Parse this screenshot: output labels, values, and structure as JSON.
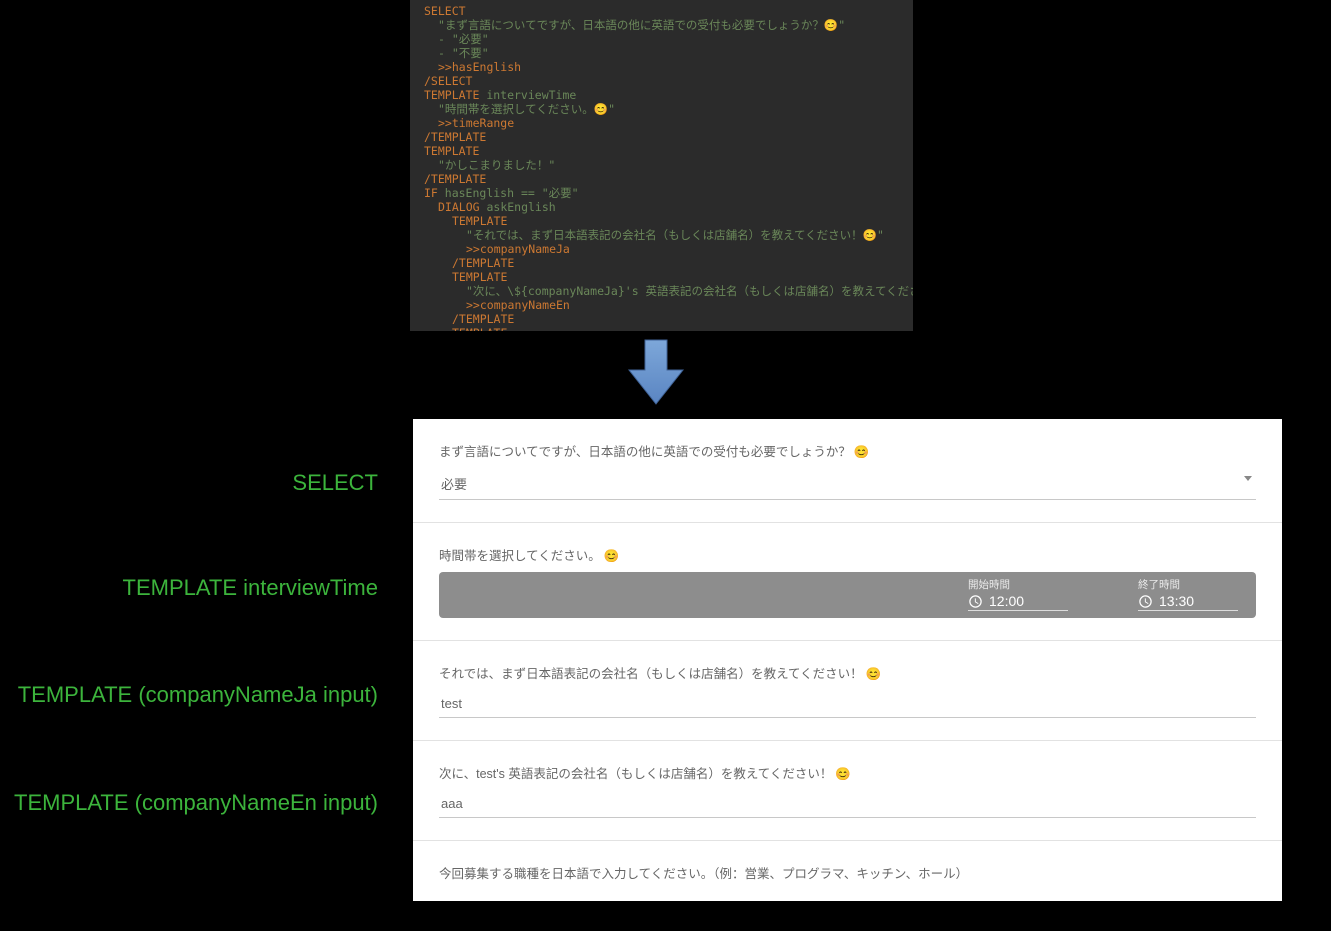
{
  "code": {
    "lines": [
      {
        "cls": "",
        "segs": [
          {
            "t": "SELECT",
            "c": "kw"
          }
        ]
      },
      {
        "cls": "i1",
        "segs": [
          {
            "t": "\"まず言語についてですが、日本語の他に英語での受付も必要でしょうか？",
            "c": "str"
          },
          {
            "t": "😊",
            "c": "emoji"
          },
          {
            "t": "\"",
            "c": "str"
          }
        ]
      },
      {
        "cls": "i1",
        "segs": [
          {
            "t": "- \"必要\"",
            "c": "str"
          }
        ]
      },
      {
        "cls": "i1",
        "segs": [
          {
            "t": "- \"不要\"",
            "c": "str"
          }
        ]
      },
      {
        "cls": "i1",
        "segs": [
          {
            "t": ">>hasEnglish",
            "c": "var"
          }
        ]
      },
      {
        "cls": "",
        "segs": [
          {
            "t": "/SELECT",
            "c": "kw"
          }
        ]
      },
      {
        "cls": "",
        "segs": [
          {
            "t": "TEMPLATE",
            "c": "kw"
          },
          {
            "t": " interviewTime",
            "c": "str"
          }
        ]
      },
      {
        "cls": "i1",
        "segs": [
          {
            "t": "\"時間帯を選択してください。",
            "c": "str"
          },
          {
            "t": "😊",
            "c": "emoji"
          },
          {
            "t": "\"",
            "c": "str"
          }
        ]
      },
      {
        "cls": "i1",
        "segs": [
          {
            "t": ">>timeRange",
            "c": "var"
          }
        ]
      },
      {
        "cls": "",
        "segs": [
          {
            "t": "/TEMPLATE",
            "c": "kw"
          }
        ]
      },
      {
        "cls": "",
        "segs": [
          {
            "t": "TEMPLATE",
            "c": "kw"
          }
        ]
      },
      {
        "cls": "i1",
        "segs": [
          {
            "t": "\"かしこまりました！\"",
            "c": "str"
          }
        ]
      },
      {
        "cls": "",
        "segs": [
          {
            "t": "/TEMPLATE",
            "c": "kw"
          }
        ]
      },
      {
        "cls": "",
        "segs": [
          {
            "t": "IF",
            "c": "kw"
          },
          {
            "t": " hasEnglish == \"必要\"",
            "c": "str"
          }
        ]
      },
      {
        "cls": "i1",
        "segs": [
          {
            "t": "DIALOG",
            "c": "kw"
          },
          {
            "t": " askEnglish",
            "c": "str"
          }
        ]
      },
      {
        "cls": "i2",
        "segs": [
          {
            "t": "TEMPLATE",
            "c": "kw"
          }
        ]
      },
      {
        "cls": "i3",
        "segs": [
          {
            "t": "\"それでは、まず日本語表記の会社名（もしくは店舗名）を教えてください！",
            "c": "str"
          },
          {
            "t": "😊",
            "c": "emoji"
          },
          {
            "t": "\"",
            "c": "str"
          }
        ]
      },
      {
        "cls": "i3",
        "segs": [
          {
            "t": ">>companyNameJa",
            "c": "var"
          }
        ]
      },
      {
        "cls": "i2",
        "segs": [
          {
            "t": "/TEMPLATE",
            "c": "kw"
          }
        ]
      },
      {
        "cls": "i2",
        "segs": [
          {
            "t": "TEMPLATE",
            "c": "kw"
          }
        ]
      },
      {
        "cls": "i3",
        "segs": [
          {
            "t": "\"次に、\\${companyNameJa}'s 英語表記の会社名（もしくは店舗名）を教えてください！",
            "c": "str"
          },
          {
            "t": "😊",
            "c": "emoji"
          },
          {
            "t": "\"",
            "c": "str"
          }
        ]
      },
      {
        "cls": "i3",
        "segs": [
          {
            "t": ">>companyNameEn",
            "c": "var"
          }
        ]
      },
      {
        "cls": "i2",
        "segs": [
          {
            "t": "/TEMPLATE",
            "c": "kw"
          }
        ]
      },
      {
        "cls": "i2",
        "segs": [
          {
            "t": "TEMPLATE",
            "c": "kw"
          }
        ]
      },
      {
        "cls": "i3",
        "segs": [
          {
            "t": "\"今回募集する職種を日本語で入力してください。（例：営業、プログラマ、キッチン、ホール）\"",
            "c": "str"
          }
        ]
      }
    ]
  },
  "sideLabels": {
    "select": "SELECT",
    "interviewTime": "TEMPLATE interviewTime",
    "companyJa": "TEMPLATE (companyNameJa input)",
    "companyEn": "TEMPLATE (companyNameEn input)"
  },
  "form": {
    "q1": {
      "label": "まず言語についてですが、日本語の他に英語での受付も必要でしょうか？",
      "emoji": "😊",
      "value": "必要"
    },
    "q2": {
      "label": "時間帯を選択してください。",
      "emoji": "😊",
      "startCap": "開始時間",
      "start": "12:00",
      "endCap": "終了時間",
      "end": "13:30"
    },
    "q3": {
      "label": "それでは、まず日本語表記の会社名（もしくは店舗名）を教えてください！",
      "emoji": "😊",
      "value": "test"
    },
    "q4": {
      "label": "次に、test's 英語表記の会社名（もしくは店舗名）を教えてください！",
      "emoji": "😊",
      "value": "aaa"
    },
    "q5": {
      "label": "今回募集する職種を日本語で入力してください。（例：営業、プログラマ、キッチン、ホール）"
    }
  }
}
